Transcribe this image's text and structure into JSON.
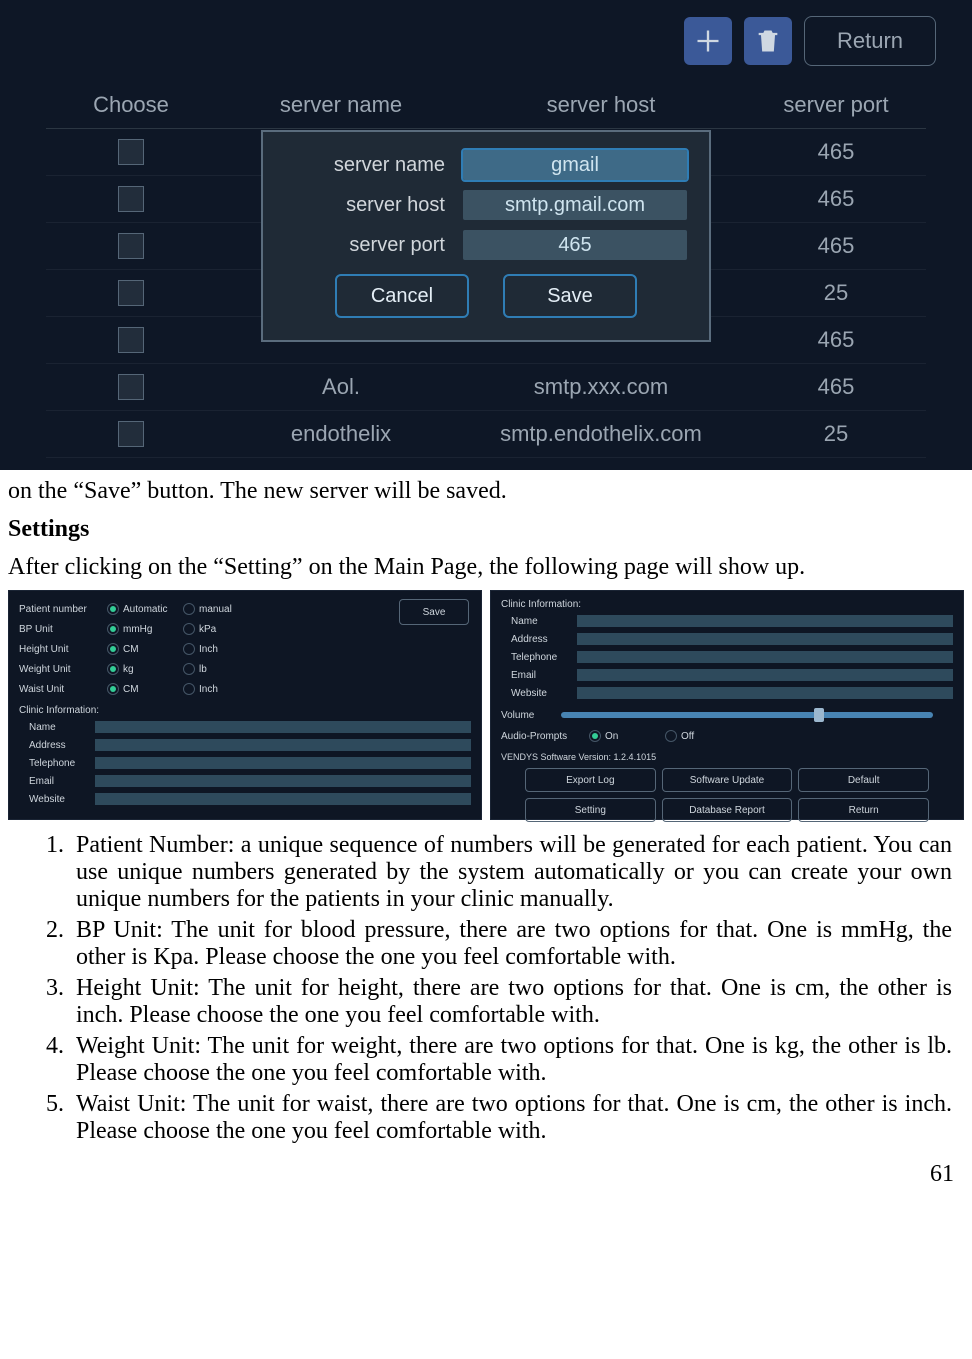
{
  "toolbar": {
    "return_label": "Return"
  },
  "server_table": {
    "headers": [
      "Choose",
      "server name",
      "server host",
      "server port"
    ],
    "rows": [
      {
        "name": "",
        "host": "",
        "port": "465"
      },
      {
        "name": "",
        "host": "",
        "port": "465"
      },
      {
        "name": "",
        "host": "",
        "port": "465"
      },
      {
        "name": "",
        "host": "",
        "port": "25"
      },
      {
        "name": "",
        "host": "",
        "port": "465"
      },
      {
        "name": "Aol.",
        "host": "smtp.xxx.com",
        "port": "465"
      },
      {
        "name": "endothelix",
        "host": "smtp.endothelix.com",
        "port": "25"
      }
    ]
  },
  "modal": {
    "labels": {
      "name": "server name",
      "host": "server host",
      "port": "server port"
    },
    "values": {
      "name": "gmail",
      "host": "smtp.gmail.com",
      "port": "465"
    },
    "cancel": "Cancel",
    "save": "Save"
  },
  "doc": {
    "line1": "on the “Save” button. The new server will be saved.",
    "heading": "Settings",
    "line2": "After clicking on the “Setting” on the Main Page, the following page will show up.",
    "page_num": "61"
  },
  "panel_left": {
    "save": "Save",
    "rows": [
      {
        "label": "Patient number",
        "a": "Automatic",
        "b": "manual"
      },
      {
        "label": "BP Unit",
        "a": "mmHg",
        "b": "kPa"
      },
      {
        "label": "Height Unit",
        "a": "CM",
        "b": "Inch"
      },
      {
        "label": "Weight Unit",
        "a": "kg",
        "b": "lb"
      },
      {
        "label": "Waist Unit",
        "a": "CM",
        "b": "Inch"
      }
    ],
    "section": "Clinic Information:",
    "fields": [
      "Name",
      "Address",
      "Telephone",
      "Email",
      "Website"
    ]
  },
  "panel_right": {
    "section": "Clinic Information:",
    "fields": [
      "Name",
      "Address",
      "Telephone",
      "Email",
      "Website"
    ],
    "volume": "Volume",
    "audio": {
      "label": "Audio-Prompts",
      "on": "On",
      "off": "Off"
    },
    "version": "VENDYS Software Version: 1.2.4.1015",
    "buttons": [
      "Export Log",
      "Software Update",
      "Default",
      "Setting",
      "Database Report",
      "Return"
    ],
    "slider_pct": 68
  },
  "list_items": [
    "Patient Number:  a unique sequence of numbers will be generated for each patient. You can use unique numbers generated by the system automatically or you can create your own unique numbers for the patients in your clinic manually.",
    "BP Unit: The unit for blood pressure, there are two options for that. One is mmHg, the other is Kpa. Please choose the one you feel comfortable with.",
    "Height Unit: The unit for height, there are two options for that. One is cm, the other is inch. Please choose the one you feel comfortable with.",
    "Weight Unit: The unit for weight, there are two options for that. One is kg, the other is lb. Please choose the one you feel comfortable with.",
    "Waist Unit: The unit for waist, there are two options for that. One is cm, the other is inch. Please choose the one you feel comfortable with."
  ]
}
